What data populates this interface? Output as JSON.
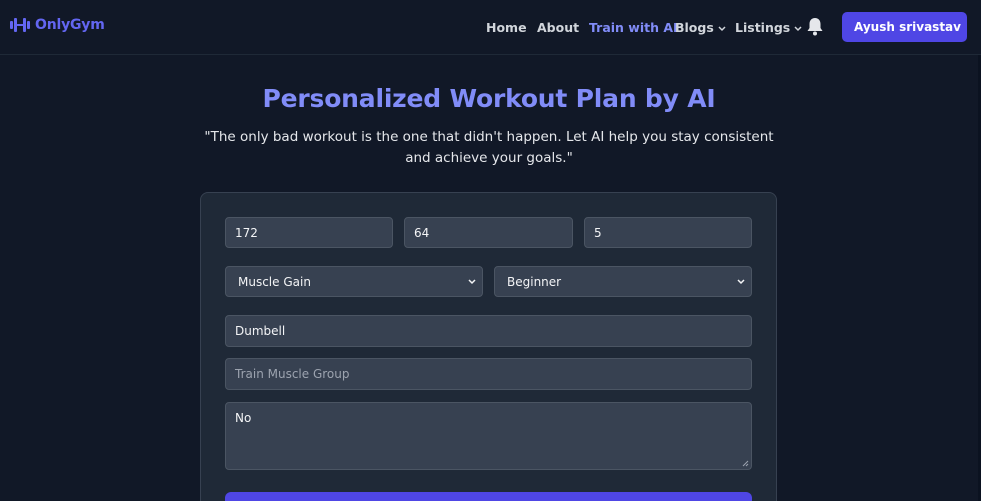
{
  "nav": {
    "brand": "OnlyGym",
    "links": [
      {
        "label": "Home"
      },
      {
        "label": "About"
      },
      {
        "label": "Train with AI"
      },
      {
        "label": "Blogs"
      },
      {
        "label": "Listings"
      }
    ],
    "user_name": "Ayush srivastav",
    "accent_color": "#6366f1",
    "active_color": "#818cf8"
  },
  "hero": {
    "title": "Personalized Workout Plan by AI",
    "quote": "\"The only bad workout is the one that didn't happen. Let AI help you stay consistent and achieve your goals.\""
  },
  "form": {
    "height_value": "172",
    "weight_value": "64",
    "third_value": "5",
    "goal_selected": "Muscle Gain",
    "level_selected": "Beginner",
    "equipment_value": "Dumbell",
    "muscle_group_placeholder": "Train Muscle Group",
    "notes_value": "No"
  }
}
